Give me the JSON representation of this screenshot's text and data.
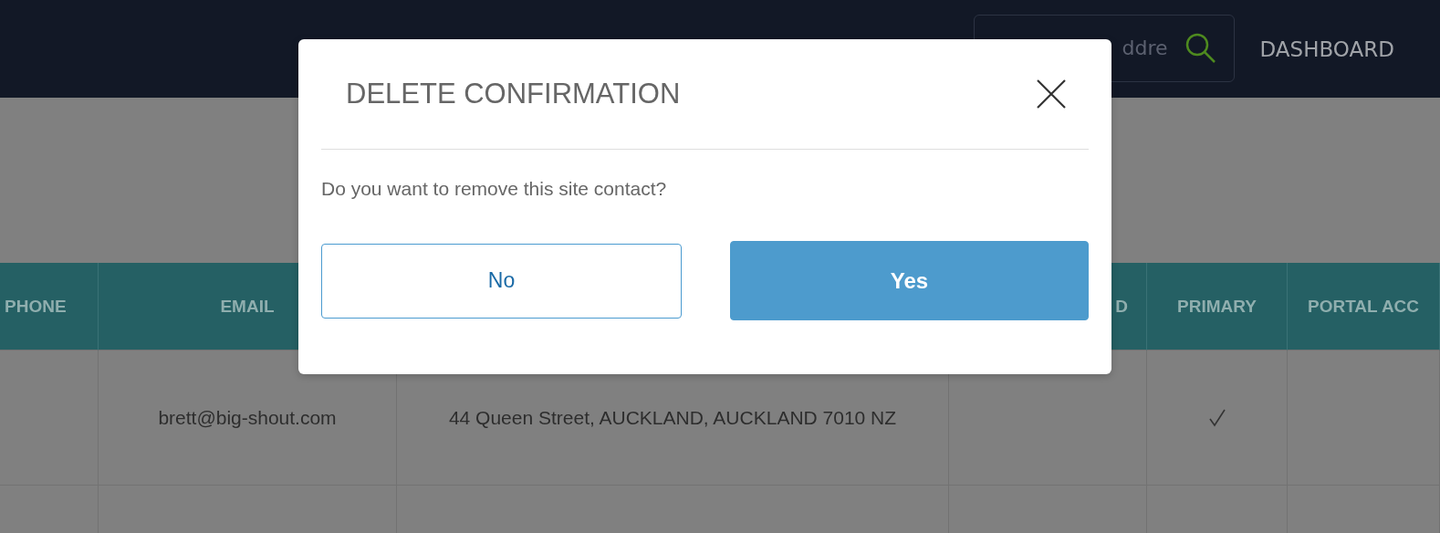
{
  "header": {
    "search": {
      "placeholder": "ddre"
    },
    "nav": [
      {
        "label": "DASHBOARD"
      }
    ]
  },
  "table": {
    "columns": [
      {
        "label": "PHONE"
      },
      {
        "label": "EMAIL"
      },
      {},
      {
        "label": "D"
      },
      {
        "label": "PRIMARY"
      },
      {
        "label": "PORTAL ACC"
      }
    ],
    "rows": [
      {
        "email": "brett@big-shout.com",
        "address": "44 Queen Street, AUCKLAND, AUCKLAND 7010 NZ",
        "primary": true
      }
    ]
  },
  "dialog": {
    "title": "DELETE CONFIRMATION",
    "message": "Do you want to remove this site contact?",
    "buttons": [
      {
        "label": "No",
        "kind": "secondary"
      },
      {
        "label": "Yes",
        "kind": "primary"
      }
    ]
  }
}
